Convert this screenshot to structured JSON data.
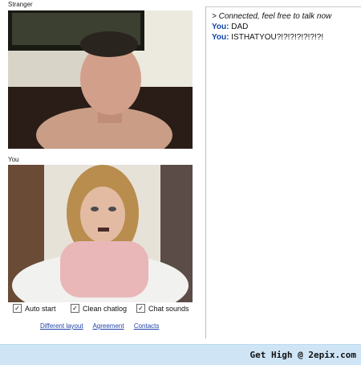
{
  "stranger_label": "Stranger",
  "you_label": "You",
  "chat": {
    "system_message": "> Connected, feel free to talk now",
    "messages": [
      {
        "speaker": "You:",
        "text": "DAD"
      },
      {
        "speaker": "You:",
        "text": "ISTHATYOU?!?!?!?!?!?!?!"
      }
    ]
  },
  "options": [
    {
      "label": "Auto start",
      "checked": true
    },
    {
      "label": "Clean chatlog",
      "checked": true
    },
    {
      "label": "Chat sounds",
      "checked": true
    }
  ],
  "links": [
    "Different layout",
    "Agreement",
    "Contacts"
  ],
  "footer_brand": "Get High @ 2epix.com"
}
